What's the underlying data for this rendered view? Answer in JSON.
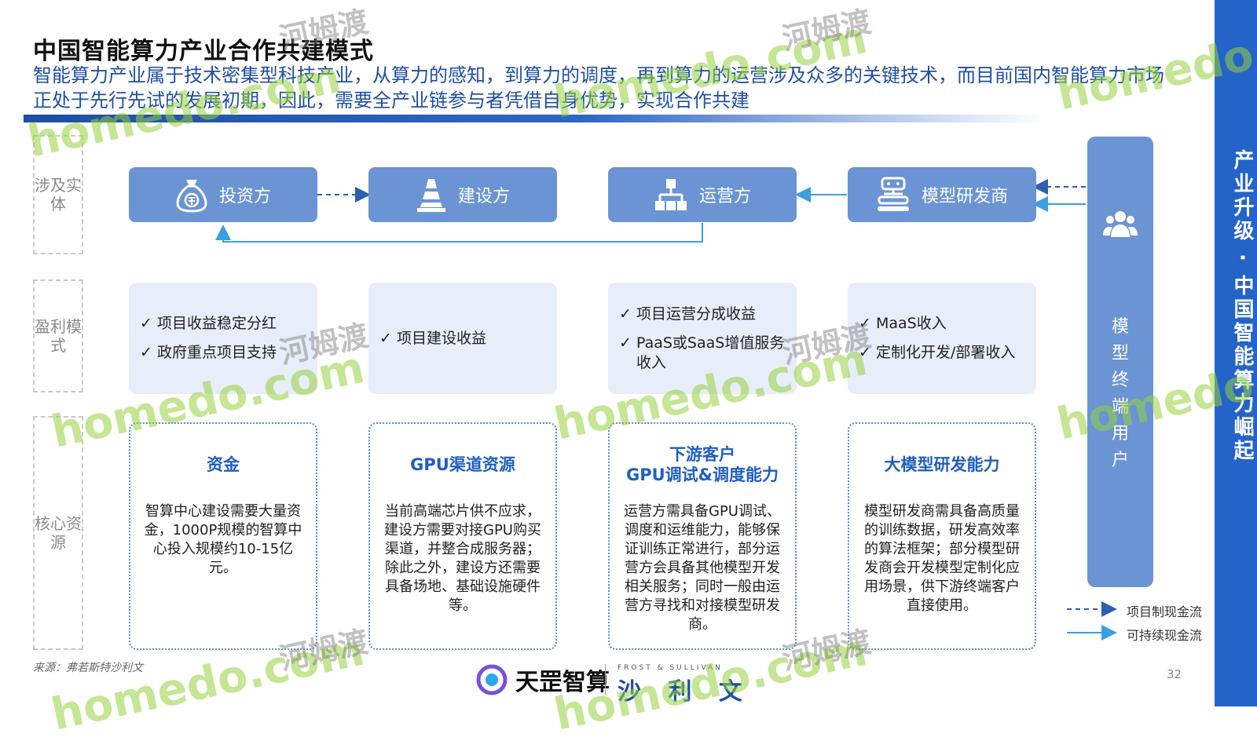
{
  "header": {
    "title": "中国智能算力产业合作共建模式",
    "subtitle": "智能算力产业属于技术密集型科技产业，从算力的感知，到算力的调度，再到算力的运营涉及众多的关键技术，而目前国内智能算力市场正处于先行先试的发展初期，因此，需要全产业链参与者凭借自身优势，实现合作共建"
  },
  "side_banner": "产业升级 · 中国智能算力崛起",
  "row_labels": {
    "entities": "涉及实体",
    "profit": "盈利模式",
    "resources": "核心资源"
  },
  "entities": [
    {
      "label": "投资方",
      "icon": "money-bag-icon"
    },
    {
      "label": "建设方",
      "icon": "traffic-cone-icon"
    },
    {
      "label": "运营方",
      "icon": "hierarchy-icon"
    },
    {
      "label": "模型研发商",
      "icon": "robot-conveyor-icon"
    }
  ],
  "profit_models": [
    [
      "项目收益稳定分红",
      "政府重点项目支持"
    ],
    [
      "项目建设收益"
    ],
    [
      "项目运营分成收益",
      "PaaS或SaaS增值服务收入"
    ],
    [
      "MaaS收入",
      "定制化开发/部署收入"
    ]
  ],
  "core_resources": [
    {
      "title": "资金",
      "body": "智算中心建设需要大量资金，1000P规模的智算中心投入规模约10-15亿元。"
    },
    {
      "title": "GPU渠道资源",
      "body": "当前高端芯片供不应求，建设方需要对接GPU购买渠道，并整合成服务器；除此之外，建设方还需要具备场地、基础设施硬件等。"
    },
    {
      "title": "下游客户\nGPU调试&调度能力",
      "body": "运营方需具备GPU调试、调度和运维能力，能够保证训练正常进行，部分运营方会具备其他模型开发相关服务；同时一般由运营方寻找和对接模型研发商。"
    },
    {
      "title": "大模型研发能力",
      "body": "模型研发商需具备高质量的训练数据，研发高效率的算法框架；部分模型研发商会开发模型定制化应用场景，供下游终端客户直接使用。"
    }
  ],
  "end_user": {
    "label": "模型终端用户",
    "icon": "users-group-icon"
  },
  "legend": {
    "dashed": "项目制现金流",
    "solid": "可持续现金流"
  },
  "colors": {
    "primary": "#6b94d4",
    "accent": "#1f4fa3",
    "side_bar": "#2464c8",
    "profit_bg": "#e7eef9",
    "arrow": "#3aa0e0"
  },
  "footer": {
    "source": "来源：弗若斯特沙利文",
    "brand_left": "天罡智算",
    "brand_right": "沙 利 文",
    "brand_right_small": "FROST & SULLIVAN",
    "page": "32"
  },
  "watermark": {
    "text_latin": "homedo.com",
    "text_cn": "河姆渡"
  }
}
